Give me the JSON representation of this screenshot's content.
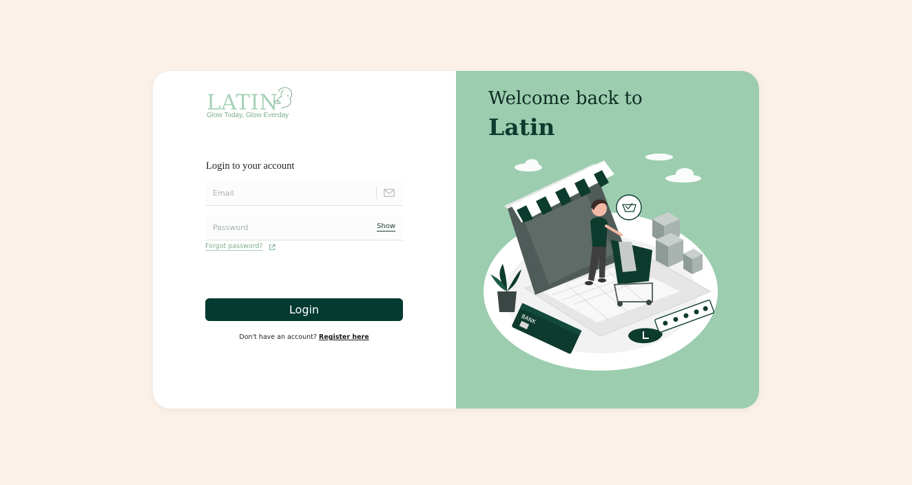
{
  "logo": {
    "wordmark": "LATIN",
    "tagline": "Glow Today, Glow Everday"
  },
  "login": {
    "heading": "Login to your account",
    "email_placeholder": "Email",
    "password_placeholder": "Password",
    "show_label": "Show",
    "forgot_label": "Forgot password?",
    "button_label": "Login",
    "register_prompt": "Don't have an account?",
    "register_link": "Register here"
  },
  "hero": {
    "welcome": "Welcome back to",
    "brand": "Latin",
    "illustration_card_label": "BANK"
  },
  "colors": {
    "page_bg": "#fbf1e9",
    "accent_dark": "#043b31",
    "panel_green": "#9ccdaf",
    "logo_green": "#a8d2b8"
  },
  "icons": [
    "mail-icon",
    "external-link-icon"
  ]
}
